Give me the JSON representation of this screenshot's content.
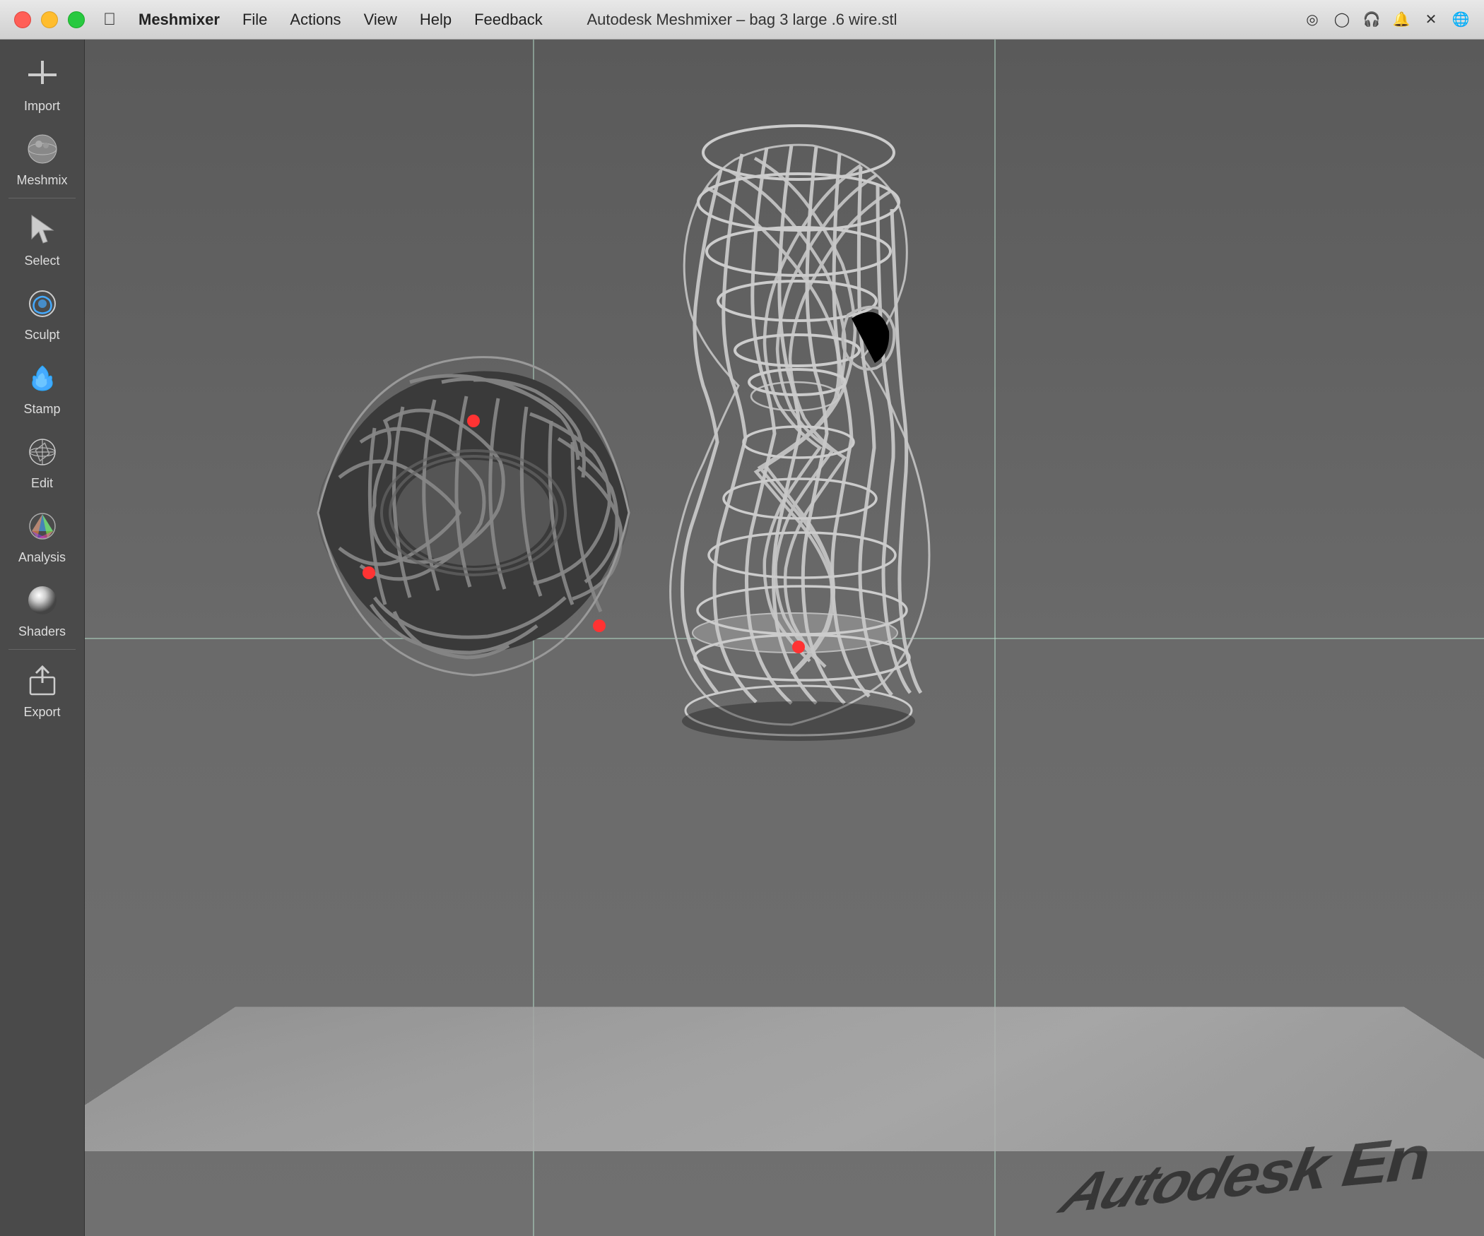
{
  "titlebar": {
    "app_name": "Meshmixer",
    "title": "Autodesk Meshmixer – bag 3 large .6 wire.stl",
    "menus": [
      "File",
      "Actions",
      "View",
      "Help",
      "Feedback"
    ]
  },
  "sidebar": {
    "items": [
      {
        "id": "import",
        "label": "Import",
        "icon": "plus-icon"
      },
      {
        "id": "meshmix",
        "label": "Meshmix",
        "icon": "meshmix-icon"
      },
      {
        "id": "select",
        "label": "Select",
        "icon": "select-icon"
      },
      {
        "id": "sculpt",
        "label": "Sculpt",
        "icon": "sculpt-icon"
      },
      {
        "id": "stamp",
        "label": "Stamp",
        "icon": "stamp-icon"
      },
      {
        "id": "edit",
        "label": "Edit",
        "icon": "edit-icon"
      },
      {
        "id": "analysis",
        "label": "Analysis",
        "icon": "analysis-icon"
      },
      {
        "id": "shaders",
        "label": "Shaders",
        "icon": "shaders-icon"
      },
      {
        "id": "export",
        "label": "Export",
        "icon": "export-icon"
      }
    ]
  },
  "viewport": {
    "background_color": "#666",
    "watermark": "Autodesk En"
  }
}
